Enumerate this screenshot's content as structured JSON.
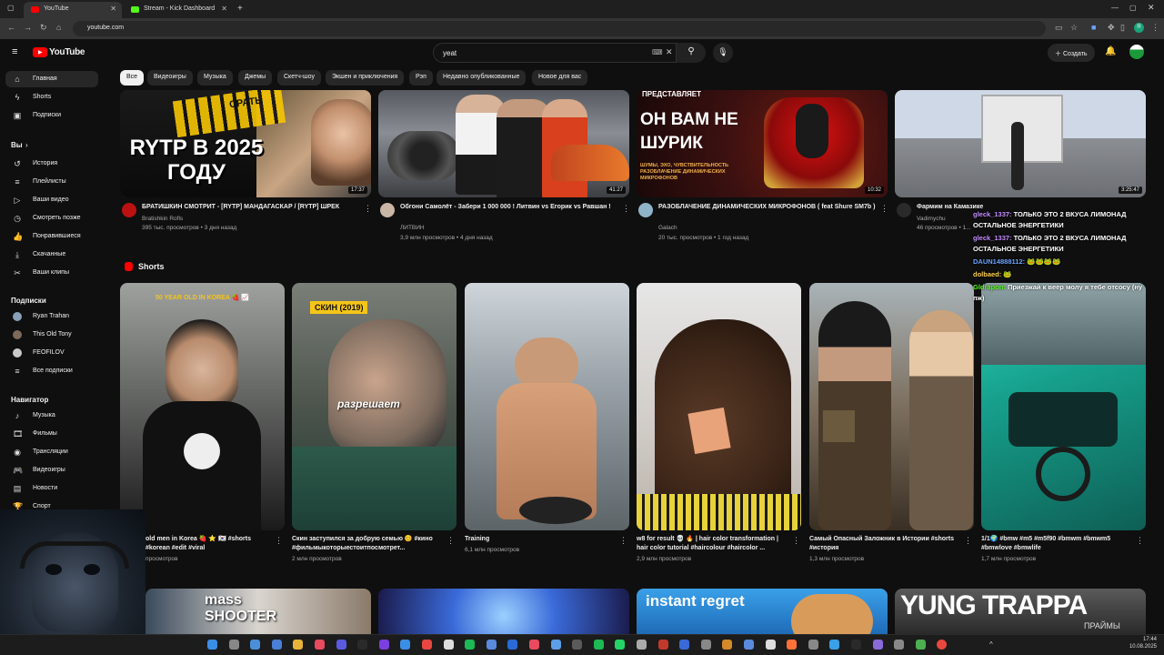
{
  "browser": {
    "tabs": [
      {
        "title": "YouTube",
        "active": true,
        "favicon_color": "#ff0000"
      },
      {
        "title": "Stream - Kick Dashboard",
        "active": false,
        "favicon_color": "#53fc18"
      }
    ],
    "url": "youtube.com"
  },
  "youtube": {
    "logo_text": "YouTube",
    "search_value": "yeat",
    "create_label": "Создать",
    "chips": [
      "Все",
      "Видеоигры",
      "Музыка",
      "Джемы",
      "Скетч-шоу",
      "Экшен и приключения",
      "Рэп",
      "Недавно опубликованные",
      "Новое для вас"
    ],
    "sidebar": {
      "main": [
        {
          "label": "Главная",
          "icon": "home-icon",
          "glyph": "⌂"
        },
        {
          "label": "Shorts",
          "icon": "shorts-icon",
          "glyph": "ϟ"
        },
        {
          "label": "Подписки",
          "icon": "subscriptions-icon",
          "glyph": "▣"
        }
      ],
      "you_heading": "Вы",
      "you": [
        {
          "label": "История",
          "icon": "history-icon",
          "glyph": "↺"
        },
        {
          "label": "Плейлисты",
          "icon": "playlists-icon",
          "glyph": "≡"
        },
        {
          "label": "Ваши видео",
          "icon": "your-videos-icon",
          "glyph": "▷"
        },
        {
          "label": "Смотреть позже",
          "icon": "watch-later-icon",
          "glyph": "◷"
        },
        {
          "label": "Понравившиеся",
          "icon": "liked-icon",
          "glyph": "👍"
        },
        {
          "label": "Скачанные",
          "icon": "downloads-icon",
          "glyph": "⤓"
        },
        {
          "label": "Ваши клипы",
          "icon": "clips-icon",
          "glyph": "✂"
        }
      ],
      "subs_heading": "Подписки",
      "subs": [
        {
          "label": "Ryan Trahan",
          "color": "#8aa0b8"
        },
        {
          "label": "This Old Tony",
          "color": "#7c6a5a"
        },
        {
          "label": "FEOFILOV",
          "color": "#c9c9c9"
        },
        {
          "label": "Все подписки",
          "glyph": "≡"
        }
      ],
      "nav_heading": "Навигатор",
      "nav": [
        {
          "label": "Музыка",
          "icon": "music-icon",
          "glyph": "♪"
        },
        {
          "label": "Фильмы",
          "icon": "movies-icon",
          "glyph": "🎞"
        },
        {
          "label": "Трансляции",
          "icon": "live-icon",
          "glyph": "◉"
        },
        {
          "label": "Видеоигры",
          "icon": "gaming-icon",
          "glyph": "🎮"
        },
        {
          "label": "Новости",
          "icon": "news-icon",
          "glyph": "▤"
        },
        {
          "label": "Спорт",
          "icon": "sports-icon",
          "glyph": "🏆"
        }
      ]
    },
    "videos": [
      {
        "title": "БРАТИШКИН СМОТРИТ - [RYTP] МАНДАГАСКАР / [RYTP] ШРЕК",
        "channel": "Bratishkin Rofls",
        "meta": "395 тыс. просмотров • 3 дня назад",
        "duration": "17:37",
        "thumb_text": "RYTP В 2025 ГОДУ",
        "thumb_top": "СРАТЬ"
      },
      {
        "title": "Обгони Самолёт - Забери 1 000 000 ! Литвин vs Егорик vs Равшан !",
        "channel": "ЛИТВИН",
        "meta": "3,9 млн просмотров • 4 дня назад",
        "duration": "41:27"
      },
      {
        "title": "РАЗОБЛАЧЕНИЕ ДИНАМИЧЕСКИХ МИКРОФОНОВ ( feat Shure SM7b )",
        "channel": "Galach",
        "meta": "20 тыс. просмотров • 1 год назад",
        "duration": "10:32",
        "thumb_text": "ОН ВАМ НЕ ШУРИК",
        "thumb_sub": "ШУМЫ, ЭХО, ЧУВСТВИТЕЛЬНОСТЬ РАЗОБЛАЧЕНИЕ ДИНАМИЧЕСКИХ МИКРОФОНОВ",
        "thumb_top": "ПРЕДСТАВЛЯЕТ"
      },
      {
        "title": "Фармим на Камазике",
        "channel": "Vadimychu",
        "meta": "46 просмотров • 1...",
        "duration": "3:25:47"
      }
    ],
    "shorts_heading": "Shorts",
    "shorts": [
      {
        "title": "old men in Korea 🍓 ⭐ 🇰🇷 #shorts #korean #edit #viral",
        "views": "просмотров",
        "overlay": "50 YEAR OLD IN KOREA 🍓 📈"
      },
      {
        "title": "Скин заступился за добрую семью 😊 #кино #фильмыкоторыестоитпосмотрет...",
        "views": "2 млн просмотров",
        "overlay": "СКИН (2019)",
        "caption": "разрешает"
      },
      {
        "title": "Training",
        "views": "6,1 млн просмотров"
      },
      {
        "title": "w8 for result 💀 🔥 | hair color transformation | hair color tutorial #haircolour #haircolor ...",
        "views": "2,9 млн просмотров"
      },
      {
        "title": "Самый Опасный Заложник в Истории #shorts #история",
        "views": "1,3 млн просмотров"
      },
      {
        "title": "1/1🌍 #bmw #m5 #m5f90 #bmwm #bmwm5 #bmwlove #bmwlife",
        "views": "1,7 млн просмотров"
      }
    ],
    "row3": [
      {
        "thumb_text": "mass SHOOTER"
      },
      {
        "thumb_text": ""
      },
      {
        "thumb_text": "instant regret"
      },
      {
        "thumb_text": "YUNG TRAPPA",
        "thumb_sub": "ПРАЙМЫ"
      }
    ]
  },
  "chat": [
    {
      "user": "gleck_1337:",
      "text": "ТОЛЬКО ЭТО 2 ВКУСА ЛИМОНАД ОСТАЛЬНОЕ ЭНЕРГЕТИКИ",
      "color": "#c58bff"
    },
    {
      "user": "gleck_1337:",
      "text": "ТОЛЬКО ЭТО 2 ВКУСА ЛИМОНАД ОСТАЛЬНОЕ ЭНЕРГЕТИКИ",
      "color": "#c58bff"
    },
    {
      "user": "DAUN14888112:",
      "text": "🐸🐸🐸🐸",
      "color": "#6aa2ff"
    },
    {
      "user": "dolbaed:",
      "text": "🐸",
      "color": "#ffd24a"
    },
    {
      "user": "Gldrapon:",
      "text": "Приезжай к веер молу я тебе отсосу (ну пж)",
      "color": "#53fc18"
    }
  ],
  "taskbar": {
    "time": "17:44",
    "date": "10.08.2025"
  }
}
